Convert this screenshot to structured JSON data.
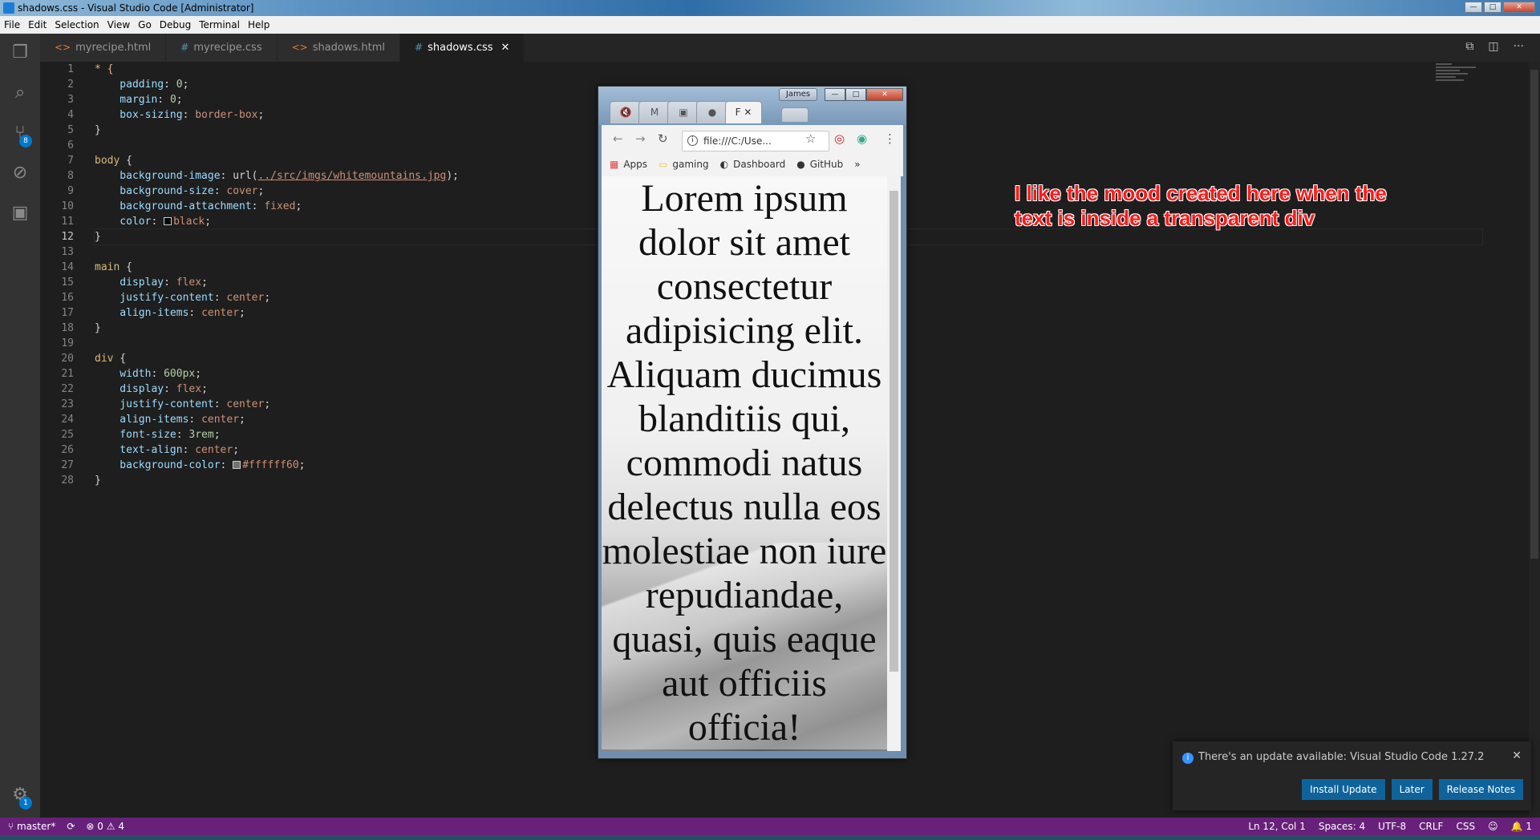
{
  "window": {
    "title": "shadows.css - Visual Studio Code [Administrator]"
  },
  "menu": [
    "File",
    "Edit",
    "Selection",
    "View",
    "Go",
    "Debug",
    "Terminal",
    "Help"
  ],
  "activity": {
    "scm_badge": "8",
    "settings_badge": "1"
  },
  "tabs": [
    {
      "label": "myrecipe.html",
      "icon": "html-file-icon"
    },
    {
      "label": "myrecipe.css",
      "icon": "css-file-icon"
    },
    {
      "label": "shadows.html",
      "icon": "html-file-icon"
    },
    {
      "label": "shadows.css",
      "icon": "css-file-icon",
      "active": true
    }
  ],
  "code": {
    "current_line": 12,
    "line_numbers": [
      "1",
      "2",
      "3",
      "4",
      "5",
      "6",
      "7",
      "8",
      "9",
      "10",
      "11",
      "12",
      "13",
      "14",
      "15",
      "16",
      "17",
      "18",
      "19",
      "20",
      "21",
      "22",
      "23",
      "24",
      "25",
      "26",
      "27",
      "28"
    ],
    "lines": [
      [
        {
          "t": "* {",
          "c": "sel"
        }
      ],
      [
        {
          "t": "    padding",
          "c": "prop"
        },
        {
          "t": ": ",
          "c": ""
        },
        {
          "t": "0",
          "c": "num"
        },
        {
          "t": ";",
          "c": ""
        }
      ],
      [
        {
          "t": "    margin",
          "c": "prop"
        },
        {
          "t": ": ",
          "c": ""
        },
        {
          "t": "0",
          "c": "num"
        },
        {
          "t": ";",
          "c": ""
        }
      ],
      [
        {
          "t": "    box-sizing",
          "c": "prop"
        },
        {
          "t": ": ",
          "c": ""
        },
        {
          "t": "border-box",
          "c": "val"
        },
        {
          "t": ";",
          "c": ""
        }
      ],
      [
        {
          "t": "}",
          "c": ""
        }
      ],
      [],
      [
        {
          "t": "body",
          "c": "sel"
        },
        {
          "t": " {",
          "c": ""
        }
      ],
      [
        {
          "t": "    background-image",
          "c": "prop"
        },
        {
          "t": ": url(",
          "c": ""
        },
        {
          "t": "../src/imgs/whitemountains.jpg",
          "c": "url"
        },
        {
          "t": ");",
          "c": ""
        }
      ],
      [
        {
          "t": "    background-size",
          "c": "prop"
        },
        {
          "t": ": ",
          "c": ""
        },
        {
          "t": "cover",
          "c": "val"
        },
        {
          "t": ";",
          "c": ""
        }
      ],
      [
        {
          "t": "    background-attachment",
          "c": "prop"
        },
        {
          "t": ": ",
          "c": ""
        },
        {
          "t": "fixed",
          "c": "val"
        },
        {
          "t": ";",
          "c": ""
        }
      ],
      [
        {
          "t": "    color",
          "c": "prop"
        },
        {
          "t": ": ",
          "c": ""
        },
        {
          "t": "",
          "c": "swatch",
          "color": "#000000"
        },
        {
          "t": "black",
          "c": "val"
        },
        {
          "t": ";",
          "c": ""
        }
      ],
      [
        {
          "t": "}",
          "c": ""
        }
      ],
      [],
      [
        {
          "t": "main",
          "c": "sel"
        },
        {
          "t": " {",
          "c": ""
        }
      ],
      [
        {
          "t": "    display",
          "c": "prop"
        },
        {
          "t": ": ",
          "c": ""
        },
        {
          "t": "flex",
          "c": "val"
        },
        {
          "t": ";",
          "c": ""
        }
      ],
      [
        {
          "t": "    justify-content",
          "c": "prop"
        },
        {
          "t": ": ",
          "c": ""
        },
        {
          "t": "center",
          "c": "val"
        },
        {
          "t": ";",
          "c": ""
        }
      ],
      [
        {
          "t": "    align-items",
          "c": "prop"
        },
        {
          "t": ": ",
          "c": ""
        },
        {
          "t": "center",
          "c": "val"
        },
        {
          "t": ";",
          "c": ""
        }
      ],
      [
        {
          "t": "}",
          "c": ""
        }
      ],
      [],
      [
        {
          "t": "div",
          "c": "sel"
        },
        {
          "t": " {",
          "c": ""
        }
      ],
      [
        {
          "t": "    width",
          "c": "prop"
        },
        {
          "t": ": ",
          "c": ""
        },
        {
          "t": "600px",
          "c": "num"
        },
        {
          "t": ";",
          "c": ""
        }
      ],
      [
        {
          "t": "    display",
          "c": "prop"
        },
        {
          "t": ": ",
          "c": ""
        },
        {
          "t": "flex",
          "c": "val"
        },
        {
          "t": ";",
          "c": ""
        }
      ],
      [
        {
          "t": "    justify-content",
          "c": "prop"
        },
        {
          "t": ": ",
          "c": ""
        },
        {
          "t": "center",
          "c": "val"
        },
        {
          "t": ";",
          "c": ""
        }
      ],
      [
        {
          "t": "    align-items",
          "c": "prop"
        },
        {
          "t": ": ",
          "c": ""
        },
        {
          "t": "center",
          "c": "val"
        },
        {
          "t": ";",
          "c": ""
        }
      ],
      [
        {
          "t": "    font-size",
          "c": "prop"
        },
        {
          "t": ": ",
          "c": ""
        },
        {
          "t": "3rem",
          "c": "num"
        },
        {
          "t": ";",
          "c": ""
        }
      ],
      [
        {
          "t": "    text-align",
          "c": "prop"
        },
        {
          "t": ": ",
          "c": ""
        },
        {
          "t": "center",
          "c": "val"
        },
        {
          "t": ";",
          "c": ""
        }
      ],
      [
        {
          "t": "    background-color",
          "c": "prop"
        },
        {
          "t": ": ",
          "c": ""
        },
        {
          "t": "",
          "c": "swatch",
          "color": "#ffffff60"
        },
        {
          "t": "#ffffff60",
          "c": "val"
        },
        {
          "t": ";",
          "c": ""
        }
      ],
      [
        {
          "t": "}",
          "c": ""
        }
      ]
    ]
  },
  "annotation": {
    "line1": "I like the mood created here when the",
    "line2": "text is inside a transparent div"
  },
  "browser": {
    "profile": "James",
    "address": "file:///C:/Use...",
    "bookmarks": [
      "Apps",
      "gaming",
      "Dashboard",
      "GitHub"
    ],
    "page_text": "Lorem ipsum dolor sit amet consectetur adipisicing elit. Aliquam ducimus blanditiis qui, commodi natus delectus nulla eos molestiae non iure repudiandae, quasi, quis eaque aut officiis officia!"
  },
  "notification": {
    "message": "There's an update available: Visual Studio Code 1.27.2",
    "install": "Install Update",
    "later": "Later",
    "notes": "Release Notes"
  },
  "status": {
    "branch": "master*",
    "errors": "0",
    "warnings": "4",
    "position": "Ln 12, Col 1",
    "spaces": "Spaces: 4",
    "encoding": "UTF-8",
    "eol": "CRLF",
    "language": "CSS",
    "notifications": "1"
  },
  "colors": {
    "statusbar": "#68217a",
    "accent": "#007acc",
    "annotation": "#ff1a1a"
  }
}
